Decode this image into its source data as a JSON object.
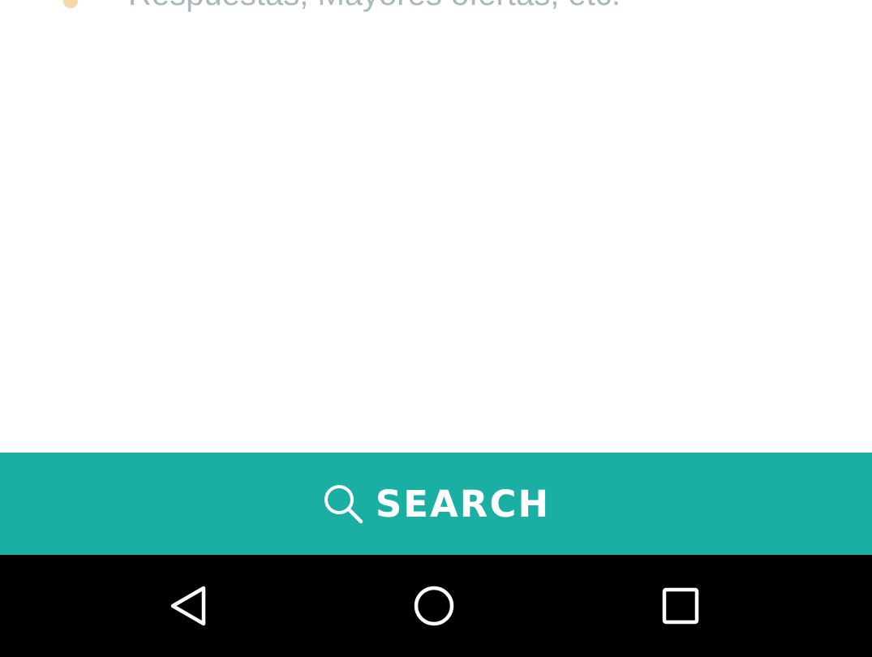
{
  "content": {
    "cut_off_text": "Respuestas, Mayores ofertas, etc."
  },
  "search_bar": {
    "label": "SEARCH",
    "icon": "search-icon",
    "color": "#1aafa2"
  },
  "nav_bar": {
    "buttons": [
      "back-icon",
      "home-icon",
      "recent-apps-icon"
    ],
    "color": "#000000"
  }
}
